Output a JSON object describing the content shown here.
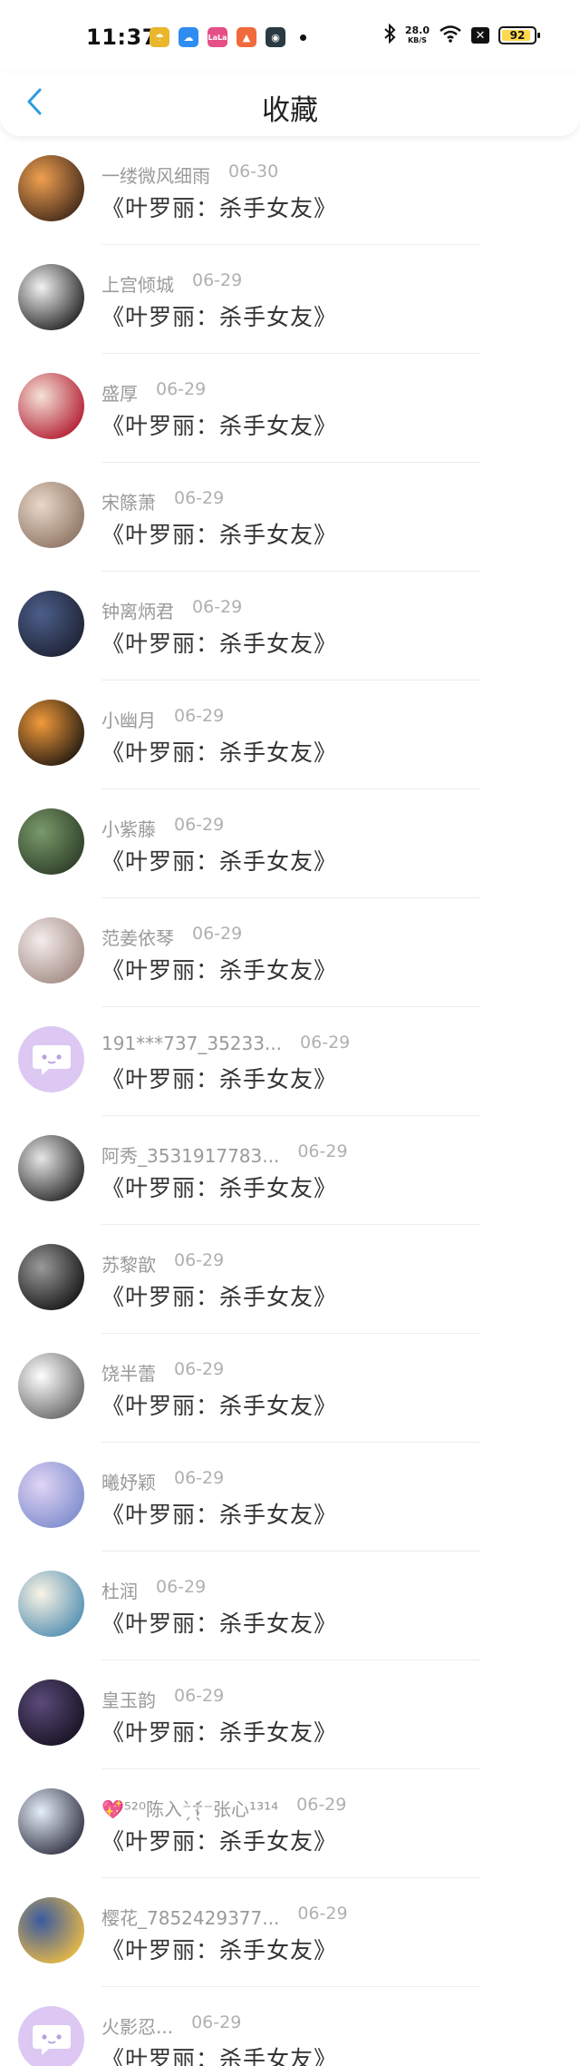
{
  "status_bar": {
    "time": "11:37",
    "net_speed_value": "28.0",
    "net_speed_unit": "KB/S",
    "battery": "92",
    "notifications": [
      {
        "icon": "weather-icon",
        "color": "#e9b62c",
        "glyph": "☂"
      },
      {
        "icon": "netdisk-icon",
        "color": "#2f8cf0",
        "glyph": "☁"
      },
      {
        "icon": "lala-icon",
        "color": "#e64e86",
        "glyph": "LaLa"
      },
      {
        "icon": "game-icon",
        "color": "#f06a3c",
        "glyph": "▲"
      },
      {
        "icon": "app-icon",
        "color": "#2b3a42",
        "glyph": "◉"
      }
    ]
  },
  "header": {
    "title": "收藏",
    "back_icon": "chevron-left-icon",
    "accent": "#2d9be0"
  },
  "items": [
    {
      "name": "一缕微风细雨",
      "date": "06-30",
      "title": "《叶罗丽：杀手女友》",
      "avatar_colors": [
        "#f0a050",
        "#3a2418"
      ]
    },
    {
      "name": "上宫倾城",
      "date": "06-29",
      "title": "《叶罗丽：杀手女友》",
      "avatar_colors": [
        "#f2f2f2",
        "#1a1a1a"
      ]
    },
    {
      "name": "盛厚",
      "date": "06-29",
      "title": "《叶罗丽：杀手女友》",
      "avatar_colors": [
        "#f4e2d6",
        "#b0142a"
      ]
    },
    {
      "name": "宋篨萧",
      "date": "06-29",
      "title": "《叶罗丽：杀手女友》",
      "avatar_colors": [
        "#e8d8c8",
        "#8a7060"
      ]
    },
    {
      "name": "钟离炳君",
      "date": "06-29",
      "title": "《叶罗丽：杀手女友》",
      "avatar_colors": [
        "#4c5e8a",
        "#1c2030"
      ]
    },
    {
      "name": "小幽月",
      "date": "06-29",
      "title": "《叶罗丽：杀手女友》",
      "avatar_colors": [
        "#f29a3a",
        "#1a1410"
      ]
    },
    {
      "name": "小紫藤",
      "date": "06-29",
      "title": "《叶罗丽：杀手女友》",
      "avatar_colors": [
        "#7a9a6a",
        "#2a3a26"
      ]
    },
    {
      "name": "范姜依琴",
      "date": "06-29",
      "title": "《叶罗丽：杀手女友》",
      "avatar_colors": [
        "#f4ecec",
        "#a08880"
      ]
    },
    {
      "name": "191***737_35233...",
      "date": "06-29",
      "title": "《叶罗丽：杀手女友》",
      "avatar_colors": [
        "#dcc8f2",
        "#dcc8f2"
      ],
      "default_avatar": true
    },
    {
      "name": "阿秀_3531917783...",
      "date": "06-29",
      "title": "《叶罗丽：杀手女友》",
      "avatar_colors": [
        "#e6e6e6",
        "#202020"
      ]
    },
    {
      "name": "苏黎歆",
      "date": "06-29",
      "title": "《叶罗丽：杀手女友》",
      "avatar_colors": [
        "#9a9a9a",
        "#101010"
      ]
    },
    {
      "name": "饶半蕾",
      "date": "06-29",
      "title": "《叶罗丽：杀手女友》",
      "avatar_colors": [
        "#ffffff",
        "#606060"
      ]
    },
    {
      "name": "曦妤颖",
      "date": "06-29",
      "title": "《叶罗丽：杀手女友》",
      "avatar_colors": [
        "#e0d4f4",
        "#7a8acc"
      ]
    },
    {
      "name": "杜润",
      "date": "06-29",
      "title": "《叶罗丽：杀手女友》",
      "avatar_colors": [
        "#fbf4e4",
        "#4a8ab0"
      ]
    },
    {
      "name": "皇玉韵",
      "date": "06-29",
      "title": "《叶罗丽：杀手女友》",
      "avatar_colors": [
        "#5a4a7a",
        "#14101e"
      ]
    },
    {
      "name": "💖⁵²⁰陈入⁻̗̀☦︎̖́⁻张心¹³¹⁴",
      "date": "06-29",
      "title": "《叶罗丽：杀手女友》",
      "avatar_colors": [
        "#e4eef8",
        "#2a2a3a"
      ]
    },
    {
      "name": "樱花_7852429377...",
      "date": "06-29",
      "title": "《叶罗丽：杀手女友》",
      "avatar_colors": [
        "#3a5aa0",
        "#f4c040"
      ]
    },
    {
      "name": "火影忍...",
      "date": "06-29",
      "title": "《叶罗丽：杀手女友》",
      "avatar_colors": [
        "#dcc8f2",
        "#dcc8f2"
      ],
      "default_avatar": true
    }
  ]
}
